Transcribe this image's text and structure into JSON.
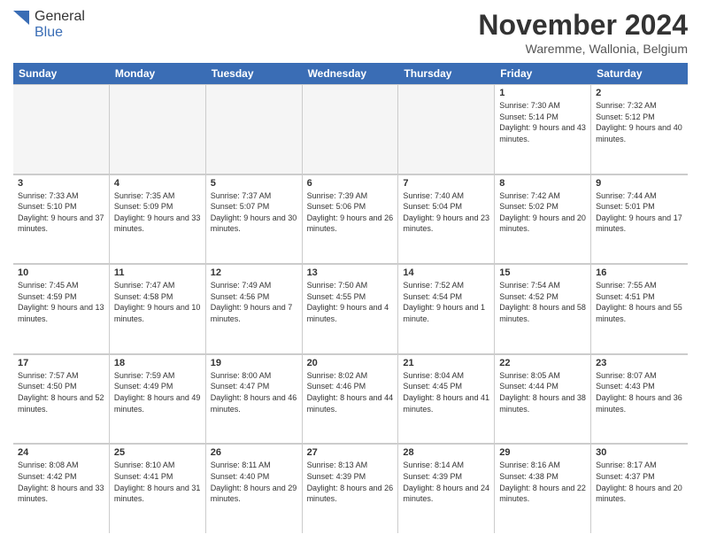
{
  "logo": {
    "line1": "General",
    "line2": "Blue"
  },
  "title": "November 2024",
  "location": "Waremme, Wallonia, Belgium",
  "columns": [
    "Sunday",
    "Monday",
    "Tuesday",
    "Wednesday",
    "Thursday",
    "Friday",
    "Saturday"
  ],
  "rows": [
    [
      {
        "day": "",
        "info": "",
        "empty": true
      },
      {
        "day": "",
        "info": "",
        "empty": true
      },
      {
        "day": "",
        "info": "",
        "empty": true
      },
      {
        "day": "",
        "info": "",
        "empty": true
      },
      {
        "day": "",
        "info": "",
        "empty": true
      },
      {
        "day": "1",
        "info": "Sunrise: 7:30 AM\nSunset: 5:14 PM\nDaylight: 9 hours and 43 minutes."
      },
      {
        "day": "2",
        "info": "Sunrise: 7:32 AM\nSunset: 5:12 PM\nDaylight: 9 hours and 40 minutes."
      }
    ],
    [
      {
        "day": "3",
        "info": "Sunrise: 7:33 AM\nSunset: 5:10 PM\nDaylight: 9 hours and 37 minutes."
      },
      {
        "day": "4",
        "info": "Sunrise: 7:35 AM\nSunset: 5:09 PM\nDaylight: 9 hours and 33 minutes."
      },
      {
        "day": "5",
        "info": "Sunrise: 7:37 AM\nSunset: 5:07 PM\nDaylight: 9 hours and 30 minutes."
      },
      {
        "day": "6",
        "info": "Sunrise: 7:39 AM\nSunset: 5:06 PM\nDaylight: 9 hours and 26 minutes."
      },
      {
        "day": "7",
        "info": "Sunrise: 7:40 AM\nSunset: 5:04 PM\nDaylight: 9 hours and 23 minutes."
      },
      {
        "day": "8",
        "info": "Sunrise: 7:42 AM\nSunset: 5:02 PM\nDaylight: 9 hours and 20 minutes."
      },
      {
        "day": "9",
        "info": "Sunrise: 7:44 AM\nSunset: 5:01 PM\nDaylight: 9 hours and 17 minutes."
      }
    ],
    [
      {
        "day": "10",
        "info": "Sunrise: 7:45 AM\nSunset: 4:59 PM\nDaylight: 9 hours and 13 minutes."
      },
      {
        "day": "11",
        "info": "Sunrise: 7:47 AM\nSunset: 4:58 PM\nDaylight: 9 hours and 10 minutes."
      },
      {
        "day": "12",
        "info": "Sunrise: 7:49 AM\nSunset: 4:56 PM\nDaylight: 9 hours and 7 minutes."
      },
      {
        "day": "13",
        "info": "Sunrise: 7:50 AM\nSunset: 4:55 PM\nDaylight: 9 hours and 4 minutes."
      },
      {
        "day": "14",
        "info": "Sunrise: 7:52 AM\nSunset: 4:54 PM\nDaylight: 9 hours and 1 minute."
      },
      {
        "day": "15",
        "info": "Sunrise: 7:54 AM\nSunset: 4:52 PM\nDaylight: 8 hours and 58 minutes."
      },
      {
        "day": "16",
        "info": "Sunrise: 7:55 AM\nSunset: 4:51 PM\nDaylight: 8 hours and 55 minutes."
      }
    ],
    [
      {
        "day": "17",
        "info": "Sunrise: 7:57 AM\nSunset: 4:50 PM\nDaylight: 8 hours and 52 minutes."
      },
      {
        "day": "18",
        "info": "Sunrise: 7:59 AM\nSunset: 4:49 PM\nDaylight: 8 hours and 49 minutes."
      },
      {
        "day": "19",
        "info": "Sunrise: 8:00 AM\nSunset: 4:47 PM\nDaylight: 8 hours and 46 minutes."
      },
      {
        "day": "20",
        "info": "Sunrise: 8:02 AM\nSunset: 4:46 PM\nDaylight: 8 hours and 44 minutes."
      },
      {
        "day": "21",
        "info": "Sunrise: 8:04 AM\nSunset: 4:45 PM\nDaylight: 8 hours and 41 minutes."
      },
      {
        "day": "22",
        "info": "Sunrise: 8:05 AM\nSunset: 4:44 PM\nDaylight: 8 hours and 38 minutes."
      },
      {
        "day": "23",
        "info": "Sunrise: 8:07 AM\nSunset: 4:43 PM\nDaylight: 8 hours and 36 minutes."
      }
    ],
    [
      {
        "day": "24",
        "info": "Sunrise: 8:08 AM\nSunset: 4:42 PM\nDaylight: 8 hours and 33 minutes."
      },
      {
        "day": "25",
        "info": "Sunrise: 8:10 AM\nSunset: 4:41 PM\nDaylight: 8 hours and 31 minutes."
      },
      {
        "day": "26",
        "info": "Sunrise: 8:11 AM\nSunset: 4:40 PM\nDaylight: 8 hours and 29 minutes."
      },
      {
        "day": "27",
        "info": "Sunrise: 8:13 AM\nSunset: 4:39 PM\nDaylight: 8 hours and 26 minutes."
      },
      {
        "day": "28",
        "info": "Sunrise: 8:14 AM\nSunset: 4:39 PM\nDaylight: 8 hours and 24 minutes."
      },
      {
        "day": "29",
        "info": "Sunrise: 8:16 AM\nSunset: 4:38 PM\nDaylight: 8 hours and 22 minutes."
      },
      {
        "day": "30",
        "info": "Sunrise: 8:17 AM\nSunset: 4:37 PM\nDaylight: 8 hours and 20 minutes."
      }
    ]
  ]
}
